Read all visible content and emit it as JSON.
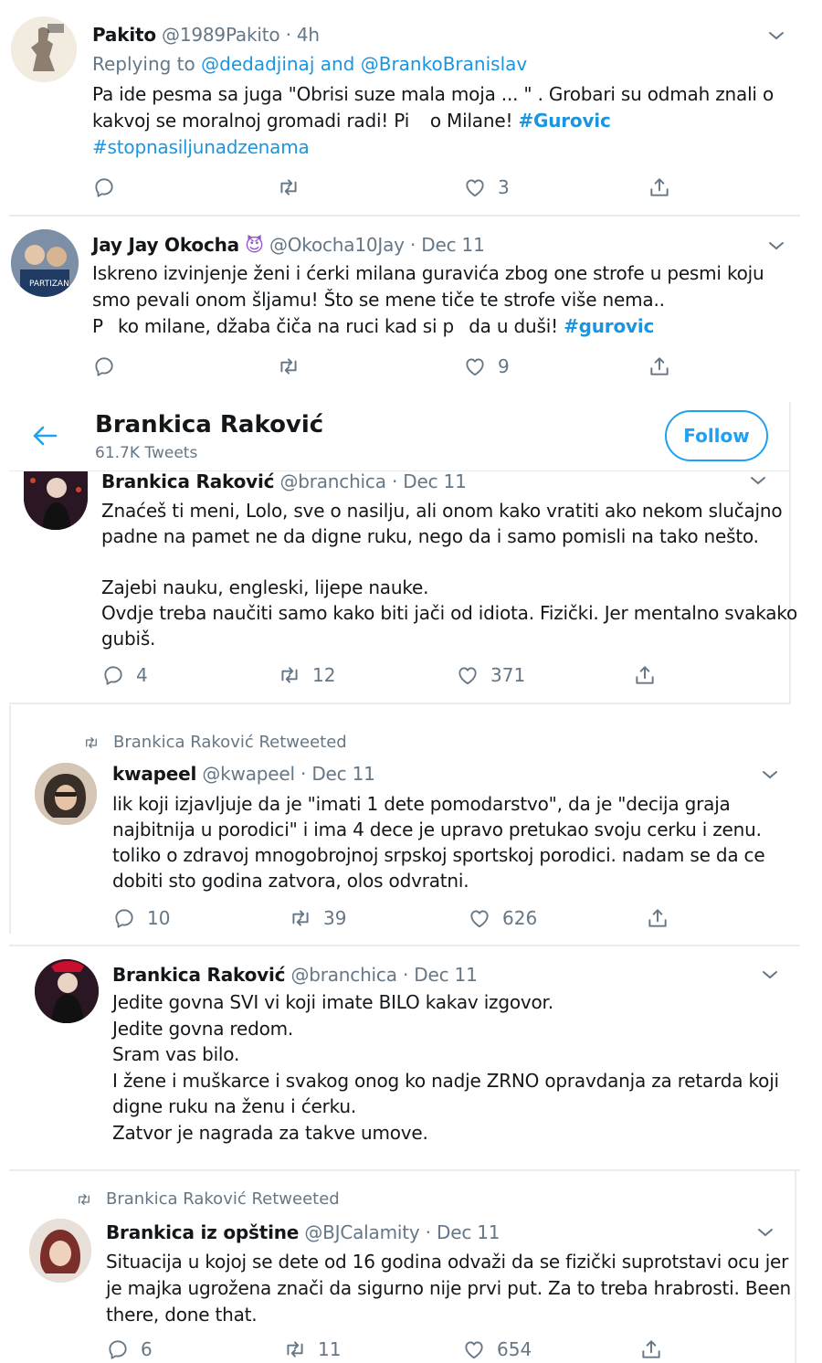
{
  "tweets": [
    {
      "name": "Pakito",
      "handle": "@1989Pakito",
      "time": "4h",
      "reply_prefix": "Replying to",
      "reply_user1": "@dedadjinaj",
      "reply_and": "and",
      "reply_user2": "@BrankoBranislav",
      "line1": "Pa ide pesma sa juga \"Obrisi suze mala moja ... \" . Grobari su odmah znali o",
      "line2_a": "kakvoj se moralnoj gromadi radi! Pi",
      "line2_b": "o Milane!",
      "line2_tag": "#Gurovic",
      "line3_tag": "#stopnasiljunadzenama",
      "likes": "3"
    },
    {
      "name": "Jay Jay Okocha",
      "emoji": "😈",
      "handle": "@Okocha10Jay",
      "time": "Dec 11",
      "line1": "Iskreno izvinjenje ženi i ćerki milana guravića zbog one strofe u pesmi koju",
      "line2": "smo pevali onom šljamu! Što se mene tiče te strofe više nema..",
      "line3_a": "P",
      "line3_b": "ko milane, džaba čiča na ruci kad si p",
      "line3_c": "da u duši!",
      "line3_tag": "#gurovic",
      "likes": "9"
    },
    {
      "name": "Brankica Raković",
      "handle": "@branchica",
      "time": "Dec 11",
      "line1": "Znaćeš ti meni, Lolo, sve o nasilju, ali onom kako vratiti ako nekom slučajno",
      "line2": "padne na pamet ne da digne ruku, nego da i samo pomisli na tako nešto.",
      "line3": "Zajebi nauku, engleski, lijepe nauke.",
      "line4": "Ovdje treba naučiti samo kako biti jači od idiota. Fizički. Jer mentalno svakako",
      "line5": "gubiš.",
      "replies": "4",
      "retweets": "12",
      "likes": "371"
    },
    {
      "retweeted_by": "Brankica Raković Retweeted",
      "name": "kwapeel",
      "handle": "@kwapeel",
      "time": "Dec 11",
      "line1": "lik koji izjavljuje da je \"imati 1 dete pomodarstvo\", da je \"decija graja",
      "line2": "najbitnija u porodici\" i ima 4 dece je upravo pretukao svoju cerku i zenu.",
      "line3": "toliko o zdravoj mnogobrojnoj srpskoj sportskoj porodici. nadam se da ce",
      "line4": "dobiti sto godina zatvora, olos odvratni.",
      "replies": "10",
      "retweets": "39",
      "likes": "626"
    },
    {
      "name": "Brankica Raković",
      "handle": "@branchica",
      "time": "Dec 11",
      "line1": "Jedite govna SVI vi koji imate BILO kakav izgovor.",
      "line2": "Jedite govna redom.",
      "line3": "Sram vas bilo.",
      "line4": "I žene i muškarce i svakog onog ko nadje ZRNO opravdanja za retarda koji",
      "line5": "digne ruku na ženu i ćerku.",
      "line6": "Zatvor je nagrada za takve umove."
    },
    {
      "retweeted_by": "Brankica Raković Retweeted",
      "name": "Brankica iz opštine",
      "handle": "@BJCalamity",
      "time": "Dec 11",
      "line1": "Situacija u kojoj se dete od 16 godina odvaži da se fizički suprotstavi ocu jer",
      "line2": "je majka ugrožena znači da sigurno nije prvi put. Za to treba hrabrosti. Been",
      "line3": "there, done that.",
      "replies": "6",
      "retweets": "11",
      "likes": "654"
    }
  ],
  "profile_header": {
    "name": "Brankica Raković",
    "tweet_count": "61.7K Tweets",
    "follow_label": "Follow"
  },
  "separator_dot": "·",
  "colors": {
    "link": "#1b95e0",
    "text": "#14171a",
    "muted": "#657786",
    "follow": "#1da1f2",
    "divider": "#e6ecf0"
  }
}
